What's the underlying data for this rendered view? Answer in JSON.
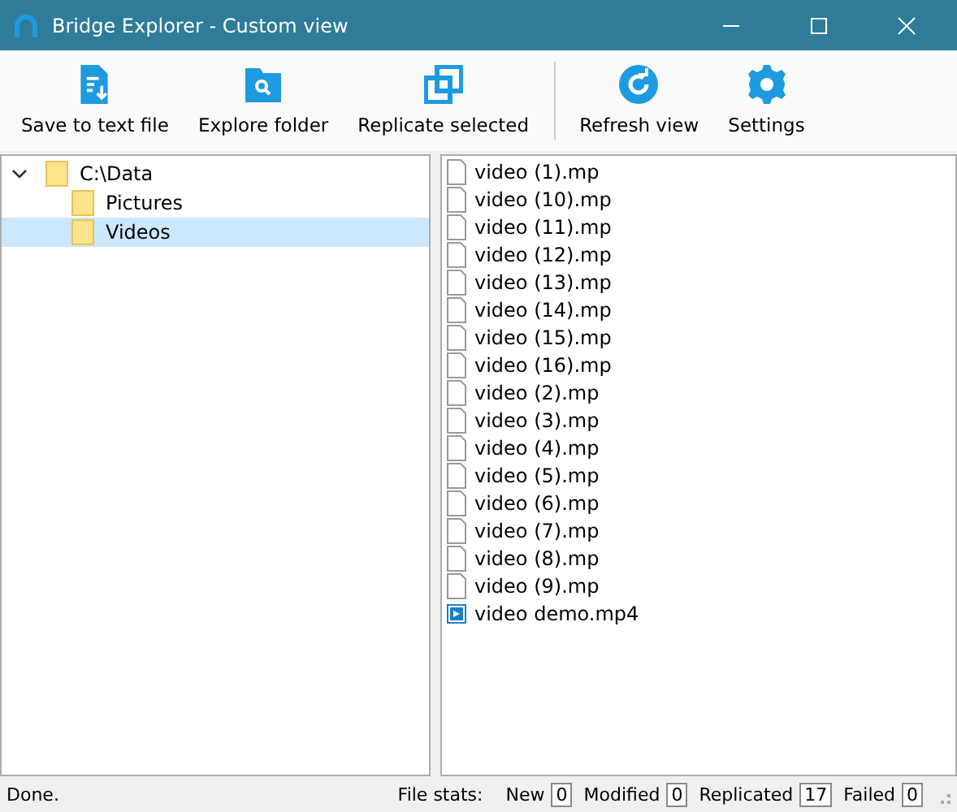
{
  "window": {
    "title": "Bridge Explorer - Custom view"
  },
  "toolbar": {
    "groups": [
      {
        "buttons": [
          {
            "label": "Save to text file",
            "kind": "save"
          },
          {
            "label": "Explore folder",
            "kind": "folder"
          },
          {
            "label": "Replicate selected",
            "kind": "replicate"
          }
        ]
      },
      {
        "buttons": [
          {
            "label": "Refresh view",
            "kind": "refresh"
          },
          {
            "label": "Settings",
            "kind": "settings"
          }
        ]
      }
    ]
  },
  "tree": [
    {
      "label": "C:\\Data",
      "expanded": true,
      "selected": false,
      "children": [
        {
          "label": "Pictures",
          "selected": false
        },
        {
          "label": "Videos",
          "selected": true
        }
      ]
    }
  ],
  "files": [
    {
      "name": "video (1).mp",
      "kind": "blank"
    },
    {
      "name": "video (10).mp",
      "kind": "blank"
    },
    {
      "name": "video (11).mp",
      "kind": "blank"
    },
    {
      "name": "video (12).mp",
      "kind": "blank"
    },
    {
      "name": "video (13).mp",
      "kind": "blank"
    },
    {
      "name": "video (14).mp",
      "kind": "blank"
    },
    {
      "name": "video (15).mp",
      "kind": "blank"
    },
    {
      "name": "video (16).mp",
      "kind": "blank"
    },
    {
      "name": "video (2).mp",
      "kind": "blank"
    },
    {
      "name": "video (3).mp",
      "kind": "blank"
    },
    {
      "name": "video (4).mp",
      "kind": "blank"
    },
    {
      "name": "video (5).mp",
      "kind": "blank"
    },
    {
      "name": "video (6).mp",
      "kind": "blank"
    },
    {
      "name": "video (7).mp",
      "kind": "blank"
    },
    {
      "name": "video (8).mp",
      "kind": "blank"
    },
    {
      "name": "video (9).mp",
      "kind": "blank"
    },
    {
      "name": "video demo.mp4",
      "kind": "video"
    }
  ],
  "status_bar": {
    "message": "Done.",
    "stats_label": "File stats:",
    "stats": [
      {
        "label": "New",
        "value": "0"
      },
      {
        "label": "Modified",
        "value": "0"
      },
      {
        "label": "Replicated",
        "value": "17"
      },
      {
        "label": "Failed",
        "value": "0"
      }
    ]
  }
}
